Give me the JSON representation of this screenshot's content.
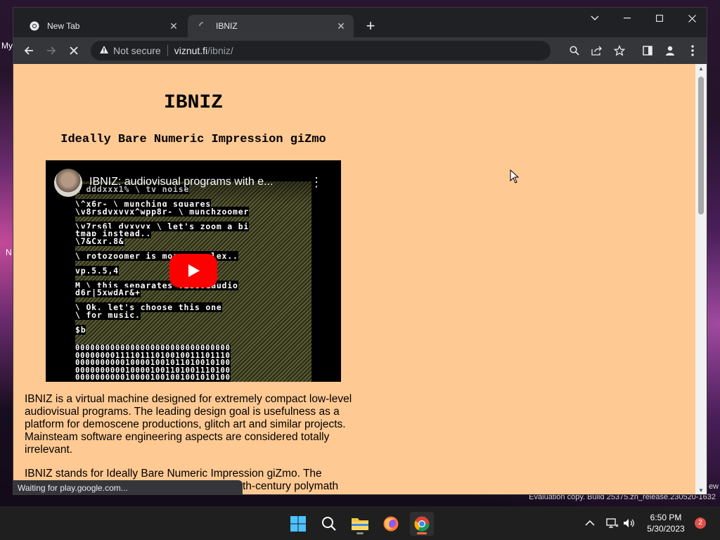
{
  "desktop": {
    "label_top": "My",
    "label_mid": "N",
    "peek_right": "ew",
    "watermark": "Evaluation copy. Build 25375.zn_release.230520-1632"
  },
  "browser": {
    "tabs": [
      {
        "title": "New Tab",
        "icon": "chrome-icon",
        "active": false
      },
      {
        "title": "IBNIZ",
        "icon": "loading-favicon",
        "active": true
      }
    ],
    "omnibox": {
      "security_label": "Not secure",
      "host": "viznut.fi",
      "path": "/ibniz/"
    },
    "status_text": "Waiting for play.google.com..."
  },
  "page": {
    "title": "IBNIZ",
    "subtitle": "Ideally Bare Numeric Impression giZmo",
    "video": {
      "title": "IBNIZ: audiovisual programs with e...",
      "code_lines": [
        "\\ dddxxx1% \\ tv noise",
        "",
        "\\^x6r- \\ munching squares",
        "\\v8rsdvxvvx^wpp8r- \\ munchzoomer",
        "",
        "\\v7rs6l dvxvvx \\ let's zoom a bi",
        "tmap instead..",
        "\\7&Cxr.8&",
        "",
        "\\ rotozoomer is more complex..",
        "",
        "vp.5.5,4",
        "",
        "M \\ this separates video&audio",
        "d6r|5xwdAr&+",
        "",
        "\\ Ok, let's choose this one",
        "\\ for music.",
        "",
        "$b"
      ],
      "binary_lines": [
        "0000000000000000000000000000000",
        "0000000011110111010010011101110",
        "0000000000100001001011010010100",
        "0000000000100001001101001110100",
        "0000000000100001001001001010100"
      ]
    },
    "para1": "IBNIZ is a virtual machine designed for extremely compact low-level audiovisual programs. The leading design goal is usefulness as a platform for demoscene productions, glitch art and similar projects. Mainsteam software engineering aspects are considered totally irrelevant.",
    "para2_line1": "IBNIZ stands for Ideally Bare Numeric Impression giZmo. The",
    "para2_line2": "th-century polymath"
  },
  "taskbar": {
    "time": "6:50 PM",
    "date": "5/30/2023",
    "notification_count": "2"
  },
  "colors": {
    "page_bg": "#ffc993",
    "chrome_dark": "#202124",
    "chrome_toolbar": "#35363a",
    "youtube_red": "#ff0000"
  }
}
